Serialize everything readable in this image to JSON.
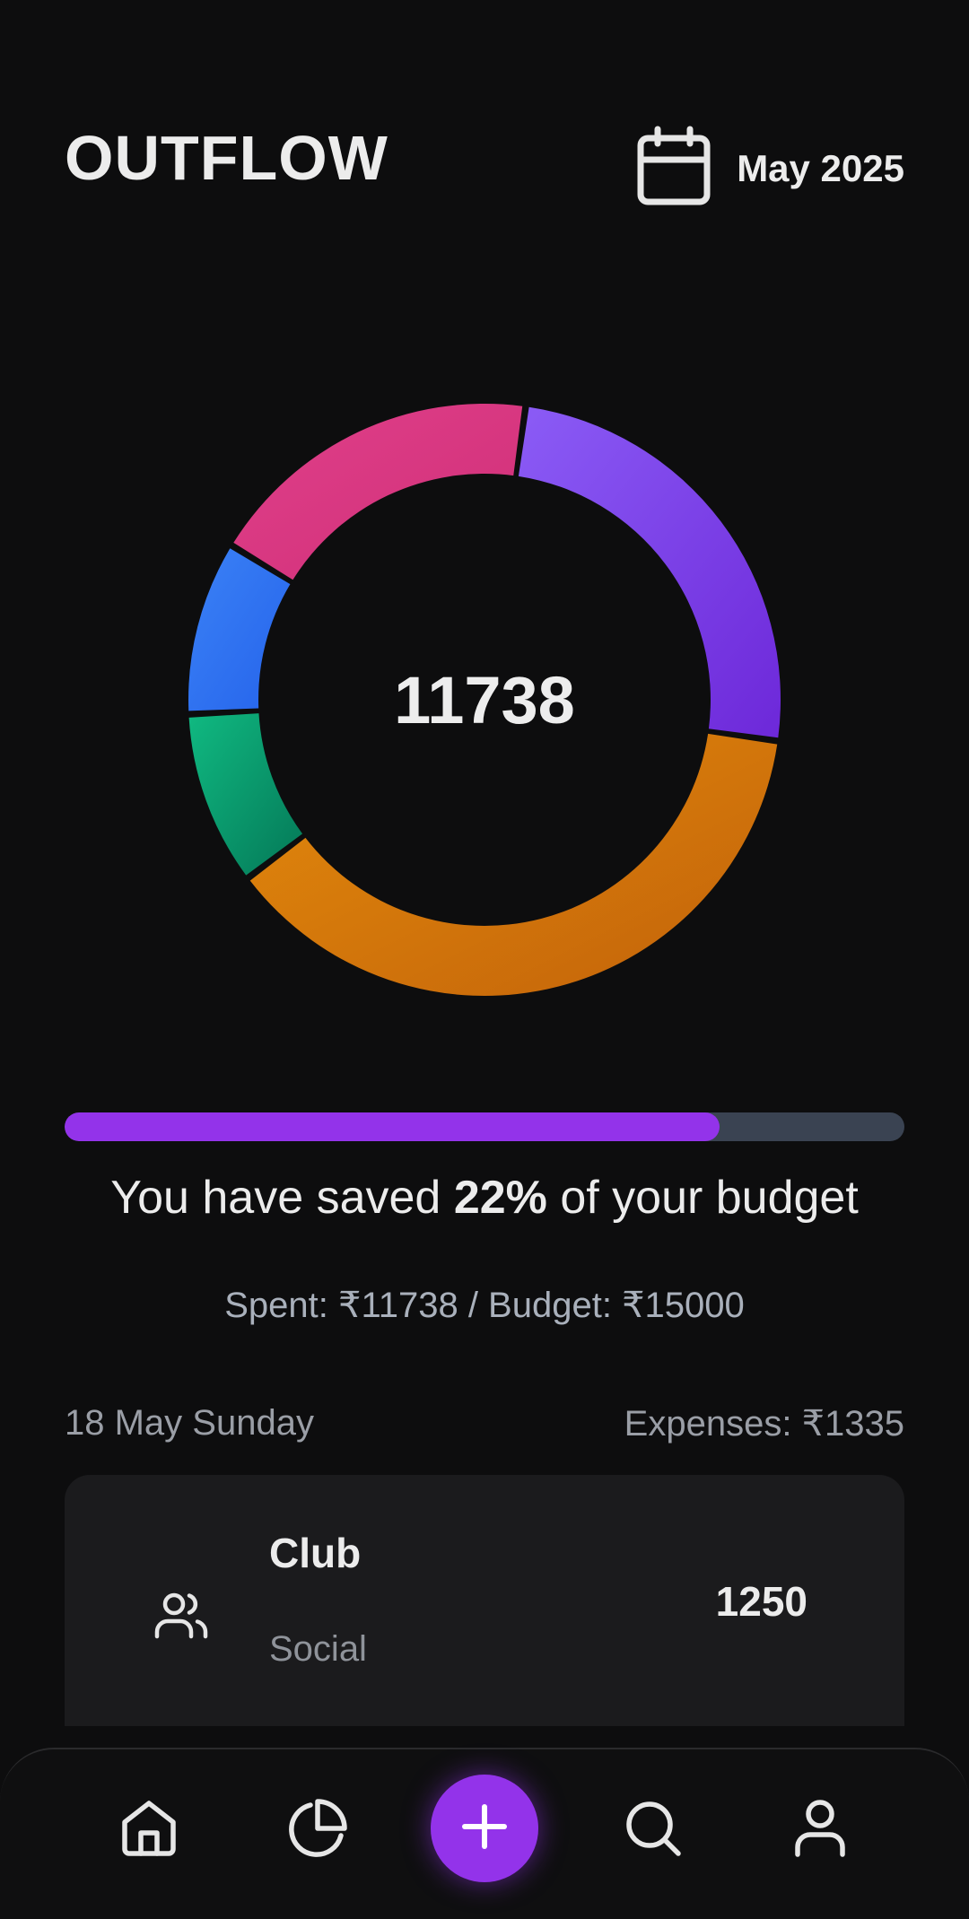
{
  "header": {
    "title": "OUTFLOW",
    "month": "May 2025",
    "calendar_icon": "calendar-icon"
  },
  "chart_data": {
    "type": "pie",
    "style": "donut",
    "center_label": "11738",
    "slices": [
      {
        "value": 0.25,
        "color_from": "#8b5cf6",
        "color_to": "#6d28d9"
      },
      {
        "value": 0.375,
        "color_from": "#e38a0c",
        "color_to": "#c2620a"
      },
      {
        "value": 0.095,
        "color_from": "#10b981",
        "color_to": "#047857"
      },
      {
        "value": 0.095,
        "color_from": "#3b82f6",
        "color_to": "#2563eb"
      },
      {
        "value": 0.185,
        "color_from": "#e0408a",
        "color_to": "#d02f78"
      }
    ]
  },
  "budget": {
    "progress": 0.78,
    "saved_prefix": "You have saved ",
    "saved_percent": "22%",
    "saved_suffix": " of your budget",
    "spent_text": "Spent: ₹11738 / Budget: ₹15000"
  },
  "day": {
    "label": "18 May Sunday",
    "expenses": "Expenses: ₹1335"
  },
  "transactions": [
    {
      "title": "Club",
      "category": "Social",
      "amount": "1250",
      "icon": "users-icon"
    }
  ],
  "nav": {
    "items": [
      "home-icon",
      "pie-chart-icon",
      "plus-icon",
      "search-icon",
      "user-icon"
    ]
  },
  "colors": {
    "accent": "#9333ea",
    "background": "#0d0d0e",
    "card": "#1b1b1d",
    "progress_track": "#3a4352"
  }
}
